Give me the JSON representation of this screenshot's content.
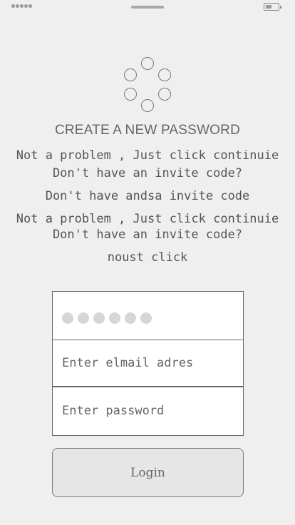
{
  "header": {
    "title": "CREATE A NEW PASSWORD"
  },
  "messages": [
    "Not a problem , Just click continuie",
    "Don't have an invite code?",
    "Don't have andsa invite code",
    "Not a problem , Just click continuie",
    "Don't have an invite code?",
    "noust click"
  ],
  "form": {
    "email_placeholder": "Enter elmail adres",
    "password_placeholder": "Enter password",
    "pin_dot_count": 6,
    "login_label": "Login"
  },
  "icons": {
    "logo": "circle-ring-logo-icon",
    "battery": "battery-icon",
    "signal": "signal-dots-icon"
  }
}
